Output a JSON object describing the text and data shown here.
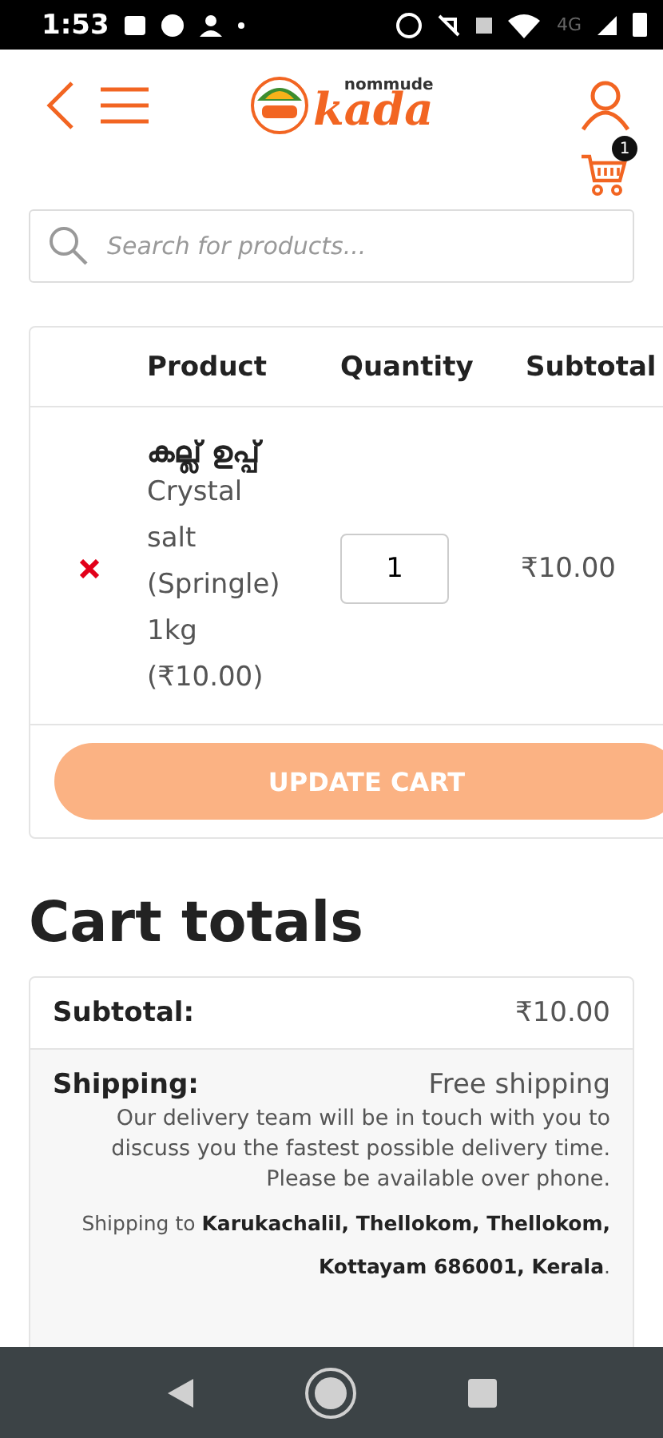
{
  "status_bar": {
    "time": "1:53",
    "network": "4G"
  },
  "header": {
    "logo": {
      "small": "nommude",
      "big": "kada"
    },
    "cart_count": "1"
  },
  "search": {
    "placeholder": "Search for products..."
  },
  "cart_table": {
    "columns": [
      "Product",
      "Quantity",
      "Subtotal"
    ],
    "rows": [
      {
        "name_local": "കല്ല് ഉപ്പ്",
        "name": "Crystal salt (Springle) 1kg (₹10.00)",
        "quantity": "1",
        "subtotal": "₹10.00"
      }
    ],
    "update_button": "UPDATE CART"
  },
  "cart_totals": {
    "title": "Cart totals",
    "subtotal_label": "Subtotal:",
    "subtotal_value": "₹10.00",
    "shipping_label": "Shipping:",
    "shipping_value": "Free shipping",
    "shipping_note": "Our delivery team will be in touch with you to discuss you the fastest possible delivery time. Please be available over phone.",
    "shipping_address": "Shipping to **Karukachalil, Thellokom, Thellokom, Kottayam 686001, Kerala**."
  }
}
